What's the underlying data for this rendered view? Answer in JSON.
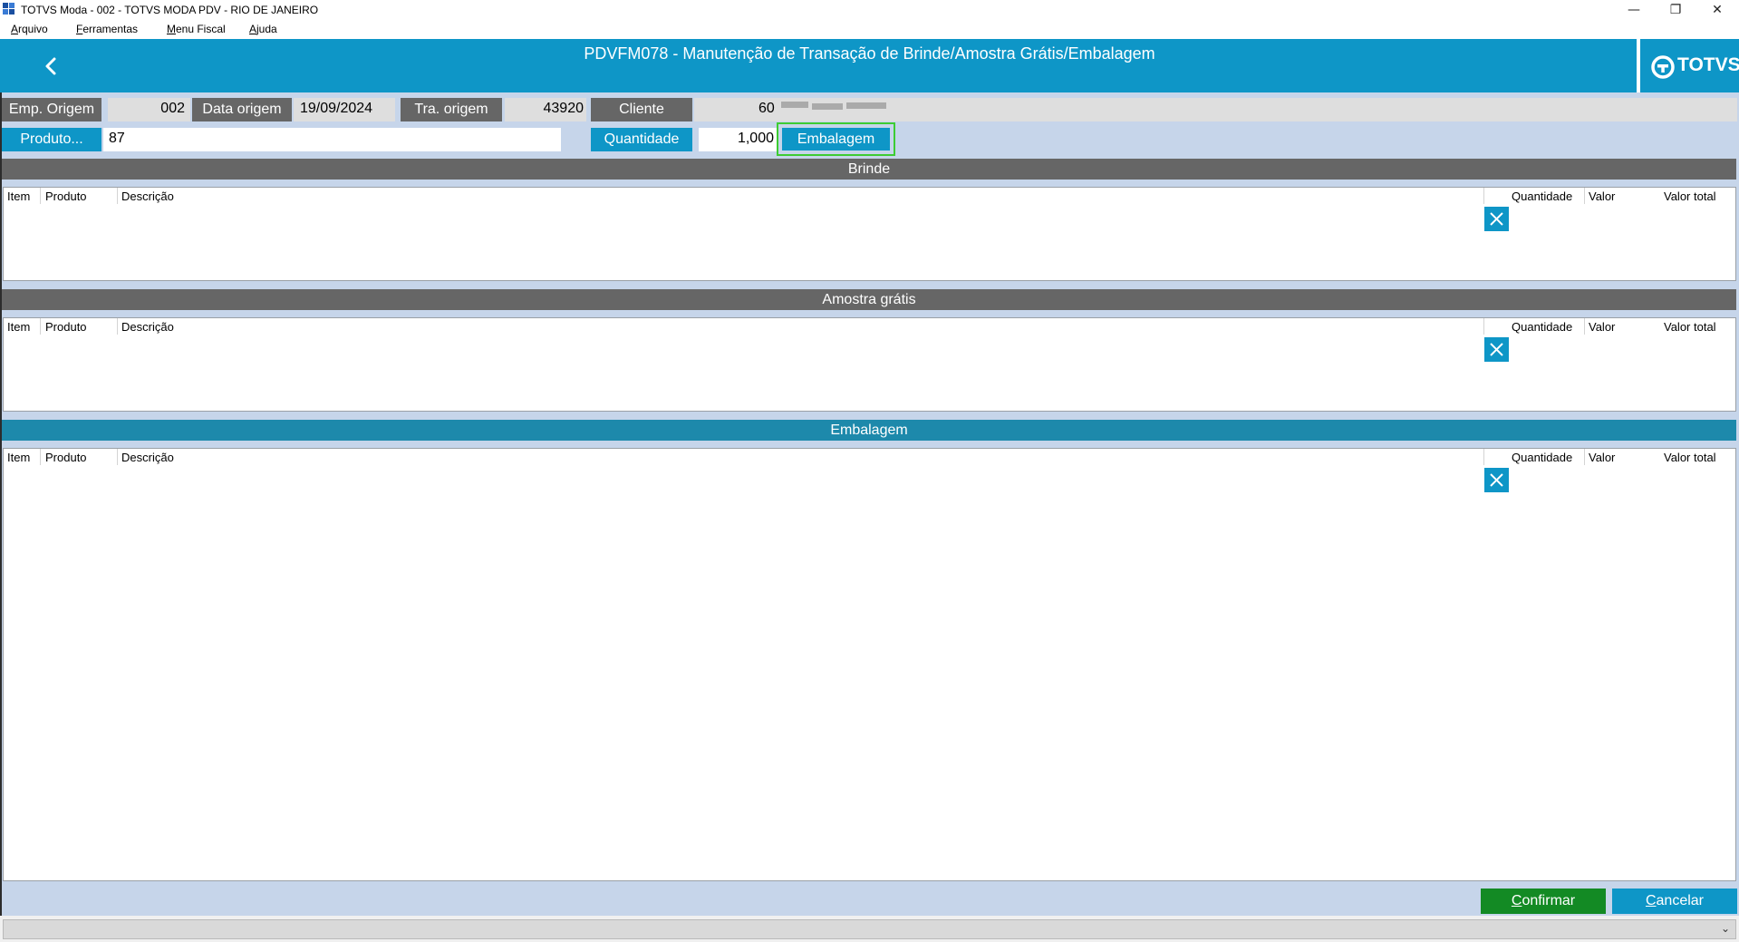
{
  "window": {
    "title": "TOTVS Moda - 002 - TOTVS MODA PDV - RIO DE JANEIRO",
    "minimize_icon": "minimize-icon",
    "restore_icon": "restore-icon",
    "close_icon": "close-icon"
  },
  "menu": [
    {
      "accel": "A",
      "rest": "rquivo"
    },
    {
      "accel": "F",
      "rest": "erramentas"
    },
    {
      "accel": "M",
      "rest": "enu Fiscal"
    },
    {
      "accel": "A",
      "rest": "juda"
    }
  ],
  "header": {
    "title": "PDVFM078 - Manutenção de Transação de Brinde/Amostra Grátis/Embalagem",
    "logo": "TOTVS",
    "back_icon": "chevron-left-icon"
  },
  "form": {
    "emp_origem_label": "Emp. Origem",
    "emp_origem_value": "002",
    "data_origem_label": "Data origem",
    "data_origem_value": "19/09/2024",
    "tra_origem_label": "Tra. origem",
    "tra_origem_value": "43920",
    "cliente_label": "Cliente",
    "cliente_value": "60",
    "produto_label": "Produto...",
    "produto_value": "87",
    "quantidade_label": "Quantidade",
    "quantidade_value": "1,000",
    "embalagem_button": "Embalagem"
  },
  "grid_columns": [
    "Item",
    "Produto",
    "Descrição",
    "Quantidade",
    "Valor",
    "Valor total"
  ],
  "sections": [
    {
      "title": "Brinde",
      "delete_icon": "close-icon"
    },
    {
      "title": "Amostra grátis",
      "delete_icon": "close-icon"
    },
    {
      "title": "Embalagem",
      "delete_icon": "close-icon"
    }
  ],
  "footer": {
    "confirm_accel": "C",
    "confirm_rest": "onfirmar",
    "cancel_accel": "C",
    "cancel_rest": "ancelar"
  },
  "colors": {
    "accent_blue": "#0e96c7",
    "dark_label": "#666666",
    "form_background": "#c6d5ea",
    "confirm_green": "#138a24",
    "highlight_green": "#3dcc33"
  }
}
